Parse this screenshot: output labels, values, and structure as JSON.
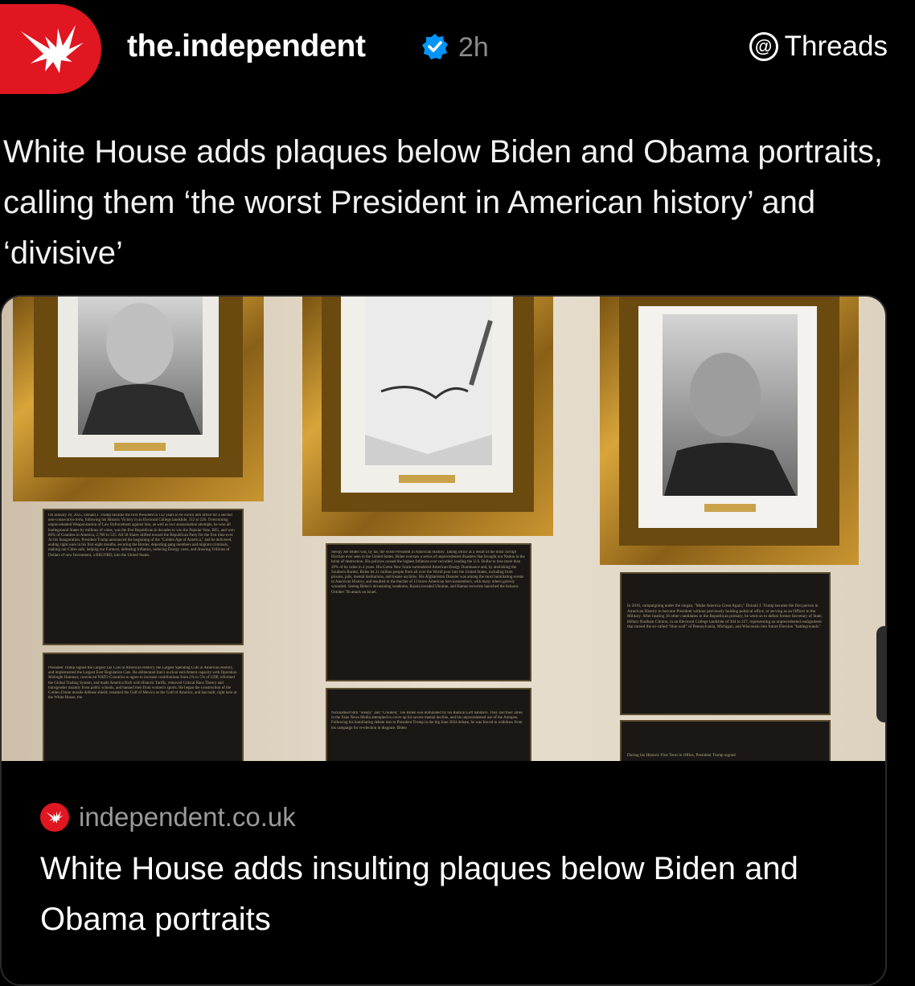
{
  "post": {
    "username": "the.independent",
    "timestamp": "2h",
    "app_label": "Threads",
    "text": "White House adds plaques below Biden and Obama portraits, calling them ‘the worst President in American history’ and ‘divisive’"
  },
  "link_card": {
    "domain": "independent.co.uk",
    "title": "White House adds insulting plaques below Biden and Obama portraits",
    "image": {
      "left_plaque_top": "On January 20, 2025, Donald J. Trump became the first President in 132 years to be sworn into office for a second non-consecutive term, following his Historic Victory in an Electoral College landslide, 312 to 226. Overcoming unprecedented Weaponization of Law Enforcement against him, as well as two assassination attempts, he won all battleground States by millions of votes, was the first Republican in decades to win the Popular Vote, RIG, and won 86% of Counties in America, 2,700 to 525. All 50 States shifted toward the Republican Party for the first time ever. At his Inauguration, President Trump announced the beginning of the \"Golden Age of America,\" and he delivered, ending right wars in his first eight months, securing the Border, deporting gang members and migrant criminals, making our Cities safe, helping our Farmers, defeating Inflation, reducing Energy costs, and drawing Trillions of Dollars of new Investment, a RECORD, into the United States.",
      "left_plaque_bottom": "President Trump signed the Largest Tax Cuts in American History, the Largest Spending Cuts in American History, and implemented the Largest Ever Regulation Cuts. He obliterated Iran's nuclear enrichment capacity with Operation Midnight Hammer, convinced NATO Countries to agree to increase contributions from 2% to 5% of GDP, reformed the Global Trading System, and made America Rich with Historic Tariffs, removed Critical Race Theory and transgender insanity from public schools, and banned men from women's sports. He began the construction of the Golden Dome missile defense shield, renamed the Gulf of Mexico as the Gulf of America, and has built, right here at the White House, the",
      "center_plaque_top": "Sleepy Joe Biden was, by far, the worst President in American History. Taking office as a result of the most corrupt Election ever seen in the United States, Biden oversaw a series of unprecedented disasters that brought our Nation to the brink of destruction. His policies caused the highest Inflation ever recorded, leading the U.S. Dollar to lose more than 20% of its value in 4 years. His Green New Scam surrendered American Energy Dominance and, by abolishing the Southern Border, Biden let 21 million people from all over the World pour into the United States, including from prisons, jails, mental institutions, and insane asylums. His Afghanistan Disaster was among the most humiliating events in American History, and resulted in the murder of 13 brave American Servicemembers, with many others gravely wounded. Seeing Biden's devastating weakness, Russia invaded Ukraine, and Hamas terrorists launched the heinous October 7th attack on Israel.",
      "center_plaque_bottom": "Nicknamed both \"Sleepy\" and \"Crooked,\" Joe Biden was dominated by his Radical Left handlers. They and their allies in the Fake News Media attempted to cover up his severe mental decline, and his unprecedented use of the Autopen. Following his humiliating debate loss to President Trump in the big June 2024 debate, he was forced to withdraw from his campaign for re-election in disgrace. Biden",
      "right_plaque_top": "In 2016, campaigning under the slogan, \"Make America Great Again,\" Donald J. Trump became the first person in American History to become President without previously holding political office, or serving as an Officer in the Military. After beating 16 other candidates in the Republican primary, he went on to defeat former Secretary of State, Hillary Rodham Clinton, in an Electoral College landslide of 304 to 227, representing an unprecedented realignment that turned the so-called \"blue wall\" of Pennsylvania, Michigan, and Wisconsin into future Election \"battlegrounds.\"",
      "right_plaque_bottom": "During his Historic First Term in Office, President Trump signed"
    }
  },
  "colors": {
    "brand_red": "#e01620",
    "verified_blue": "#0095f6",
    "muted_text": "#8b8b8b"
  }
}
